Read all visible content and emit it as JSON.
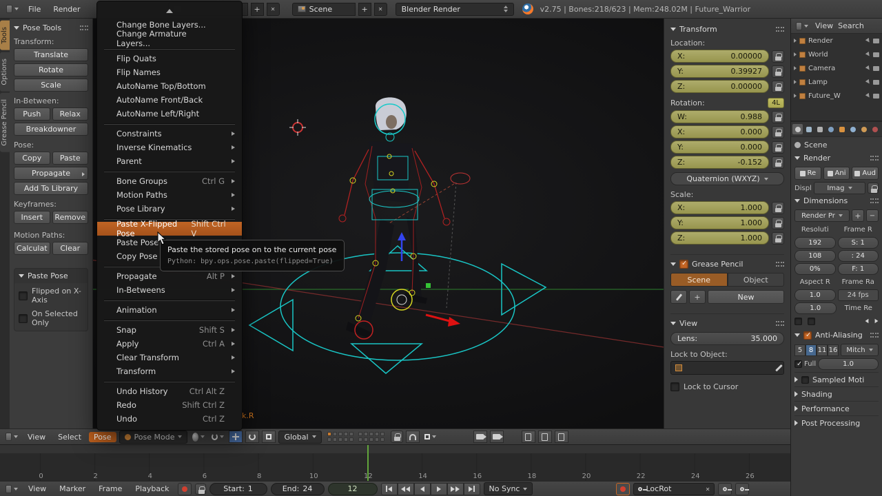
{
  "colors": {
    "accent": "#c0611e",
    "keyed_field": "#a3a05c",
    "selection_blue": "#46688f",
    "current_frame_green": "#62a53c",
    "ik_label_orange": "#d87a1e"
  },
  "icons": {
    "dropdown_arrow": "▾",
    "submenu_arrow": "▸",
    "panel_open": "▼",
    "panel_closed": "►",
    "close": "✕",
    "add": "+",
    "remove": "−",
    "scroll_up": "▲",
    "check": "✓"
  },
  "topbar": {
    "menu_file": "File",
    "menu_render": "Render",
    "screen_name": "",
    "scene_name": "Scene",
    "engine": "Blender Render",
    "stats": "v2.75 | Bones:218/623 | Mem:248.02M | Future_Warrior"
  },
  "tool_tabs": [
    {
      "label": "Tools",
      "active": true
    },
    {
      "label": "Options",
      "active": false
    },
    {
      "label": "Grease Pencil",
      "active": false
    }
  ],
  "shelf": {
    "panel_title": "Pose Tools",
    "transform_label": "Transform:",
    "btn_translate": "Translate",
    "btn_rotate": "Rotate",
    "btn_scale": "Scale",
    "inbetween_label": "In-Between:",
    "btn_push": "Push",
    "btn_relax": "Relax",
    "btn_breakdowner": "Breakdowner",
    "pose_label": "Pose:",
    "btn_copy": "Copy",
    "btn_paste": "Paste",
    "btn_propagate": "Propagate",
    "btn_add_library": "Add To Library",
    "keyframes_label": "Keyframes:",
    "btn_insert": "Insert",
    "btn_remove": "Remove",
    "motion_label": "Motion Paths:",
    "btn_calculate": "Calculat",
    "btn_clear": "Clear",
    "paste_pose_title": "Paste Pose",
    "chk_flipped": "Flipped on X-Axis",
    "chk_selected": "On Selected Only"
  },
  "menu": {
    "items": [
      {
        "label": "Change Bone Layers..."
      },
      {
        "label": "Change Armature Layers..."
      },
      {
        "sep": true
      },
      {
        "label": "Flip Quats"
      },
      {
        "label": "Flip Names"
      },
      {
        "label": "AutoName Top/Bottom"
      },
      {
        "label": "AutoName Front/Back"
      },
      {
        "label": "AutoName Left/Right"
      },
      {
        "sep": true
      },
      {
        "label": "Constraints",
        "submenu": true
      },
      {
        "label": "Inverse Kinematics",
        "submenu": true
      },
      {
        "label": "Parent",
        "submenu": true
      },
      {
        "sep": true
      },
      {
        "label": "Bone Groups",
        "shortcut": "Ctrl G",
        "submenu": true
      },
      {
        "label": "Motion Paths",
        "submenu": true
      },
      {
        "label": "Pose Library",
        "submenu": true
      },
      {
        "sep": true
      },
      {
        "label": "Paste X-Flipped Pose",
        "shortcut": "Shift Ctrl V",
        "highlight": true
      },
      {
        "label": "Paste Pose"
      },
      {
        "label": "Copy Pose"
      },
      {
        "sep": true
      },
      {
        "label": "Propagate",
        "shortcut": "Alt P",
        "submenu": true
      },
      {
        "label": "In-Betweens",
        "submenu": true
      },
      {
        "sep": true
      },
      {
        "label": "Animation",
        "submenu": true
      },
      {
        "sep": true
      },
      {
        "label": "Snap",
        "shortcut": "Shift S",
        "submenu": true
      },
      {
        "label": "Apply",
        "shortcut": "Ctrl A",
        "submenu": true
      },
      {
        "label": "Clear Transform",
        "submenu": true
      },
      {
        "label": "Transform",
        "submenu": true
      },
      {
        "sep": true
      },
      {
        "label": "Undo History",
        "shortcut": "Ctrl Alt Z"
      },
      {
        "label": "Redo",
        "shortcut": "Shift Ctrl Z"
      },
      {
        "label": "Undo",
        "shortcut": "Ctrl Z"
      }
    ]
  },
  "tooltip": {
    "text": "Paste the stored pose on to the current pose",
    "python": "Python: bpy.ops.pose.paste(flipped=True)"
  },
  "viewport": {
    "ik_label": "ik.R"
  },
  "npanel": {
    "transform_title": "Transform",
    "location_label": "Location:",
    "loc": [
      {
        "axis": "X:",
        "value": "0.00000"
      },
      {
        "axis": "Y:",
        "value": "0.39927"
      },
      {
        "axis": "Z:",
        "value": "0.00000"
      }
    ],
    "rotation_label": "Rotation:",
    "lock_4l": "4L",
    "rot": [
      {
        "axis": "W:",
        "value": "0.988"
      },
      {
        "axis": "X:",
        "value": "0.000"
      },
      {
        "axis": "Y:",
        "value": "0.000"
      },
      {
        "axis": "Z:",
        "value": "-0.152"
      }
    ],
    "rot_mode": "Quaternion (WXYZ)",
    "scale_label": "Scale:",
    "scale": [
      {
        "axis": "X:",
        "value": "1.000"
      },
      {
        "axis": "Y:",
        "value": "1.000"
      },
      {
        "axis": "Z:",
        "value": "1.000"
      }
    ],
    "gp_title": "Grease Pencil",
    "gp_tab_scene": "Scene",
    "gp_tab_object": "Object",
    "gp_new": "New",
    "view_title": "View",
    "lens_label": "Lens:",
    "lens_value": "35.000",
    "lock_object_label": "Lock to Object:",
    "lock_cursor_label": "Lock to Cursor"
  },
  "outliner": {
    "view": "View",
    "search": "Search",
    "rows": [
      {
        "label": "Render"
      },
      {
        "label": "World"
      },
      {
        "label": "Camera"
      },
      {
        "label": "Lamp"
      },
      {
        "label": "Future_W"
      }
    ]
  },
  "props": {
    "scene_crumb": "Scene",
    "render_title": "Render",
    "btn_render": "Re",
    "btn_anim": "Ani",
    "btn_audio": "Aud",
    "display_label": "Displ",
    "display_value": "Imag",
    "dim_title": "Dimensions",
    "preset": "Render Pr",
    "rows": [
      {
        "lt": "Resoluti",
        "rt": "Frame R"
      },
      {
        "lt": "192",
        "ls": true,
        "rt": "S: 1",
        "rs": true
      },
      {
        "lt": "108",
        "ls": true,
        "rt": ": 24",
        "rs": true
      },
      {
        "lt": "0%",
        "ls": true,
        "rt": "F: 1",
        "rs": true
      },
      {
        "lt": "Aspect R",
        "rt": "Frame Ra"
      },
      {
        "lt": "1.0",
        "ls": true,
        "rt": "24 fps",
        "rd": true
      },
      {
        "lt": "1.0",
        "ls": true,
        "rt": "Time Re"
      }
    ],
    "aa_title": "Anti-Aliasing",
    "aa_samples": [
      {
        "label": "5"
      },
      {
        "label": "8",
        "active": true
      },
      {
        "label": "11"
      },
      {
        "label": "16"
      }
    ],
    "aa_filter": "Mitch",
    "aa_full": "Full",
    "aa_full_value": "1.0",
    "panel_sampled": "Sampled Moti",
    "panel_shading": "Shading",
    "panel_performance": "Performance",
    "panel_post": "Post Processing"
  },
  "vheader": {
    "menu_view": "View",
    "menu_select": "Select",
    "menu_pose": "Pose",
    "mode": "Pose Mode",
    "orientation": "Global"
  },
  "timeline": {
    "ticks": [
      "0",
      "2",
      "4",
      "6",
      "8",
      "10",
      "12",
      "14",
      "16",
      "18",
      "20",
      "22",
      "24",
      "26"
    ],
    "menu_view": "View",
    "menu_marker": "Marker",
    "menu_frame": "Frame",
    "menu_playback": "Playback",
    "start_label": "Start:",
    "start_value": "1",
    "end_label": "End:",
    "end_value": "24",
    "frame_value": "12",
    "sync": "No Sync",
    "keying_set": "LocRot"
  }
}
